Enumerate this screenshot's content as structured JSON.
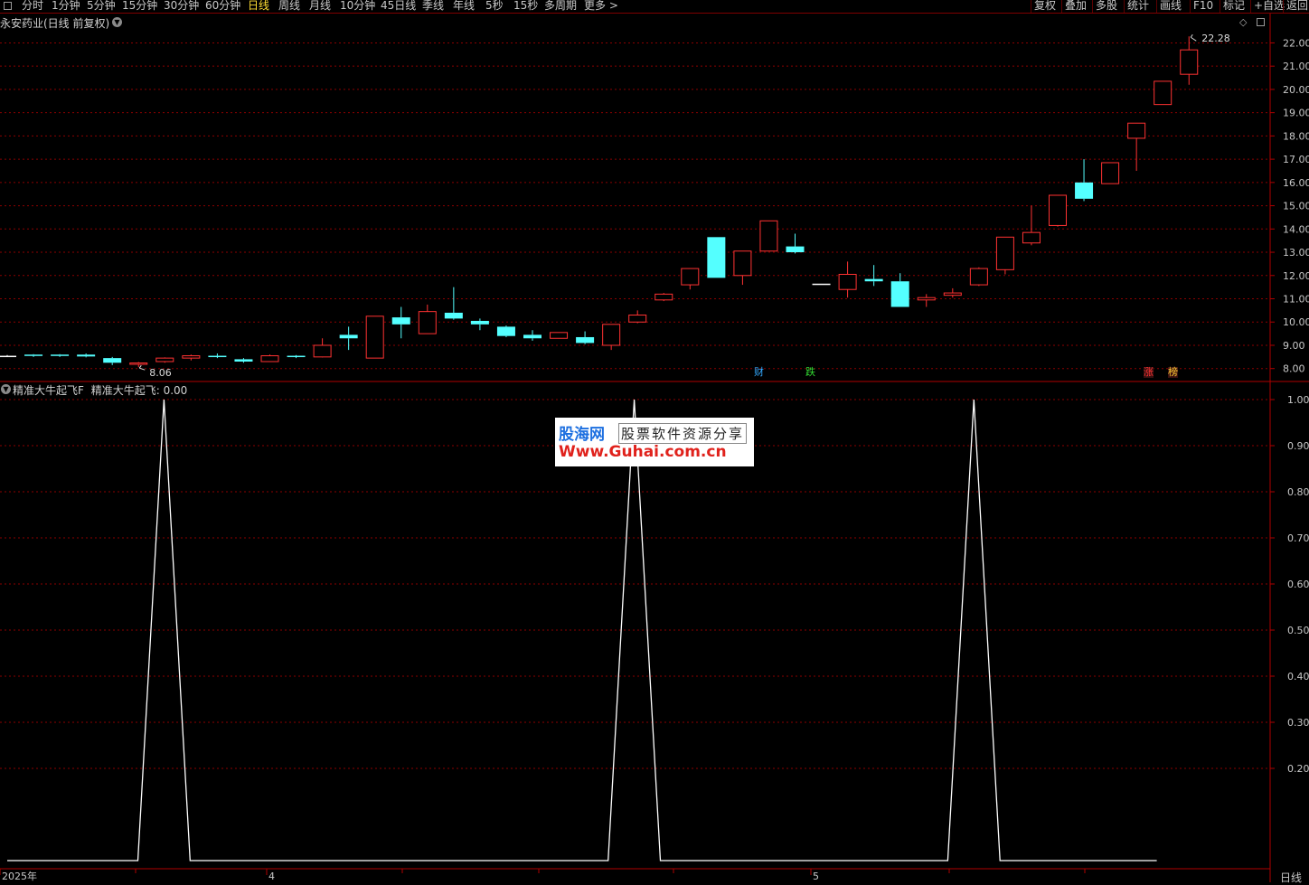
{
  "toolbar": {
    "periods": [
      "分时",
      "1分钟",
      "5分钟",
      "15分钟",
      "30分钟",
      "60分钟",
      "日线",
      "周线",
      "月线",
      "10分钟",
      "45日线",
      "季线",
      "年线",
      "5秒",
      "15秒",
      "多周期",
      "更多 >"
    ],
    "active_period": "日线",
    "right_buttons": [
      "复权",
      "叠加",
      "多股",
      "统计",
      "画线",
      "F10",
      "标记",
      "+自选",
      "返回"
    ]
  },
  "main_chart": {
    "title": "永安药业(日线 前复权)",
    "y_ticks": [
      "22.00",
      "21.00",
      "20.00",
      "19.00",
      "18.00",
      "17.00",
      "16.00",
      "15.00",
      "14.00",
      "13.00",
      "12.00",
      "11.00",
      "10.00",
      "9.00",
      "8.00"
    ],
    "high_label": "22.28",
    "low_label": "8.06",
    "markers": [
      {
        "text": "财",
        "color": "#33aaff"
      },
      {
        "text": "跌",
        "color": "#33dd33"
      },
      {
        "text": "涨",
        "color": "#ff3333"
      },
      {
        "text": "榜",
        "color": "#ffcc33"
      }
    ]
  },
  "indicator": {
    "title": "精准大牛起飞F",
    "value_label": "精准大牛起飞: 0.00",
    "y_ticks": [
      "1.00",
      "0.90",
      "0.80",
      "0.70",
      "0.60",
      "0.50",
      "0.40",
      "0.30",
      "0.20"
    ]
  },
  "x_axis": {
    "labels": [
      "2025年",
      "4",
      "5"
    ]
  },
  "period_tag": "日线",
  "watermark": {
    "brand": "股海网",
    "slogan": "股票软件资源分享",
    "url": "Www.Guhai.com.cn"
  },
  "colors": {
    "up": "#ff3232",
    "down": "#54ffff",
    "grid": "#8b0000",
    "indicator_line": "#ffffff"
  },
  "chart_data": [
    {
      "type": "candlestick",
      "title": "永安药业(日线 前复权)",
      "ylim": [
        7.6,
        22.6
      ],
      "candles": [
        {
          "o": 8.55,
          "c": 8.55,
          "h": 8.58,
          "l": 8.52,
          "dir": "flat"
        },
        {
          "o": 8.6,
          "c": 8.55,
          "h": 8.62,
          "l": 8.5,
          "dir": "down"
        },
        {
          "o": 8.6,
          "c": 8.55,
          "h": 8.62,
          "l": 8.5,
          "dir": "down"
        },
        {
          "o": 8.6,
          "c": 8.52,
          "h": 8.65,
          "l": 8.48,
          "dir": "down"
        },
        {
          "o": 8.45,
          "c": 8.25,
          "h": 8.5,
          "l": 8.15,
          "dir": "down"
        },
        {
          "o": 8.24,
          "c": 8.22,
          "h": 8.28,
          "l": 8.06,
          "dir": "up"
        },
        {
          "o": 8.3,
          "c": 8.45,
          "h": 8.48,
          "l": 8.25,
          "dir": "up"
        },
        {
          "o": 8.45,
          "c": 8.55,
          "h": 8.6,
          "l": 8.35,
          "dir": "up"
        },
        {
          "o": 8.55,
          "c": 8.52,
          "h": 8.65,
          "l": 8.45,
          "dir": "down"
        },
        {
          "o": 8.4,
          "c": 8.3,
          "h": 8.45,
          "l": 8.25,
          "dir": "down"
        },
        {
          "o": 8.3,
          "c": 8.55,
          "h": 8.6,
          "l": 8.28,
          "dir": "up"
        },
        {
          "o": 8.55,
          "c": 8.52,
          "h": 8.58,
          "l": 8.45,
          "dir": "down"
        },
        {
          "o": 8.5,
          "c": 9.0,
          "h": 9.3,
          "l": 8.48,
          "dir": "up"
        },
        {
          "o": 9.45,
          "c": 9.3,
          "h": 9.8,
          "l": 8.8,
          "dir": "down"
        },
        {
          "o": 8.45,
          "c": 10.25,
          "h": 10.25,
          "l": 8.45,
          "dir": "up"
        },
        {
          "o": 10.2,
          "c": 9.9,
          "h": 10.65,
          "l": 9.3,
          "dir": "down"
        },
        {
          "o": 9.5,
          "c": 10.45,
          "h": 10.75,
          "l": 9.5,
          "dir": "up"
        },
        {
          "o": 10.4,
          "c": 10.15,
          "h": 11.5,
          "l": 10.1,
          "dir": "down"
        },
        {
          "o": 10.05,
          "c": 9.9,
          "h": 10.15,
          "l": 9.65,
          "dir": "down"
        },
        {
          "o": 9.8,
          "c": 9.4,
          "h": 9.85,
          "l": 9.35,
          "dir": "down"
        },
        {
          "o": 9.45,
          "c": 9.3,
          "h": 9.65,
          "l": 9.2,
          "dir": "down"
        },
        {
          "o": 9.3,
          "c": 9.55,
          "h": 9.55,
          "l": 9.3,
          "dir": "up"
        },
        {
          "o": 9.35,
          "c": 9.1,
          "h": 9.6,
          "l": 9.05,
          "dir": "down"
        },
        {
          "o": 9.0,
          "c": 9.9,
          "h": 9.9,
          "l": 8.8,
          "dir": "up"
        },
        {
          "o": 10.0,
          "c": 10.3,
          "h": 10.5,
          "l": 9.95,
          "dir": "up"
        },
        {
          "o": 10.95,
          "c": 11.2,
          "h": 11.25,
          "l": 10.9,
          "dir": "up"
        },
        {
          "o": 11.6,
          "c": 12.3,
          "h": 12.3,
          "l": 11.4,
          "dir": "up"
        },
        {
          "o": 13.65,
          "c": 11.9,
          "h": 13.65,
          "l": 11.9,
          "dir": "down"
        },
        {
          "o": 12.0,
          "c": 13.05,
          "h": 13.05,
          "l": 11.6,
          "dir": "up"
        },
        {
          "o": 13.05,
          "c": 14.35,
          "h": 14.35,
          "l": 13.05,
          "dir": "up"
        },
        {
          "o": 13.25,
          "c": 13.0,
          "h": 13.8,
          "l": 12.95,
          "dir": "down"
        },
        {
          "o": 11.65,
          "c": 11.65,
          "h": 11.65,
          "l": 11.65,
          "dir": "flat"
        },
        {
          "o": 11.4,
          "c": 12.05,
          "h": 12.6,
          "l": 11.05,
          "dir": "up"
        },
        {
          "o": 11.85,
          "c": 11.75,
          "h": 12.45,
          "l": 11.55,
          "dir": "down"
        },
        {
          "o": 11.75,
          "c": 10.65,
          "h": 12.1,
          "l": 10.65,
          "dir": "down"
        },
        {
          "o": 10.95,
          "c": 11.05,
          "h": 11.2,
          "l": 10.65,
          "dir": "up"
        },
        {
          "o": 11.15,
          "c": 11.25,
          "h": 11.45,
          "l": 11.05,
          "dir": "up"
        },
        {
          "o": 11.6,
          "c": 12.3,
          "h": 12.35,
          "l": 11.55,
          "dir": "up"
        },
        {
          "o": 12.25,
          "c": 13.65,
          "h": 13.65,
          "l": 12.05,
          "dir": "up"
        },
        {
          "o": 13.4,
          "c": 13.85,
          "h": 15.0,
          "l": 13.3,
          "dir": "up"
        },
        {
          "o": 14.15,
          "c": 15.45,
          "h": 15.45,
          "l": 14.1,
          "dir": "up"
        },
        {
          "o": 16.0,
          "c": 15.3,
          "h": 17.0,
          "l": 15.2,
          "dir": "down"
        },
        {
          "o": 15.95,
          "c": 16.85,
          "h": 16.85,
          "l": 15.95,
          "dir": "up"
        },
        {
          "o": 17.9,
          "c": 18.55,
          "h": 18.55,
          "l": 16.5,
          "dir": "up"
        },
        {
          "o": 19.35,
          "c": 20.35,
          "h": 20.35,
          "l": 19.35,
          "dir": "up"
        },
        {
          "o": 20.65,
          "c": 21.7,
          "h": 22.28,
          "l": 20.2,
          "dir": "up"
        }
      ]
    },
    {
      "type": "line",
      "title": "精准大牛起飞F",
      "ylim": [
        0,
        1
      ],
      "series": [
        {
          "values": [
            0,
            0,
            0,
            0,
            0,
            0,
            1,
            0,
            0,
            0,
            0,
            0,
            0,
            0,
            0,
            0,
            0,
            0,
            0,
            0,
            0,
            0,
            0,
            0,
            1,
            0,
            0,
            0,
            0,
            0,
            0,
            0,
            0,
            0,
            0,
            0,
            0,
            1,
            0,
            0,
            0,
            0,
            0,
            0,
            0
          ]
        }
      ]
    }
  ]
}
